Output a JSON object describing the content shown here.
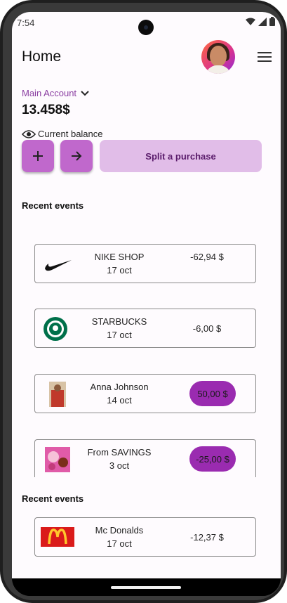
{
  "status_bar": {
    "time": "7:54"
  },
  "header": {
    "title": "Home"
  },
  "account": {
    "name": "Main Account",
    "balance": "13.458$",
    "balance_label": "Current balance"
  },
  "actions": {
    "add_icon": "plus-icon",
    "transfer_icon": "arrow-right-icon",
    "split_label": "Split a purchase"
  },
  "sections": {
    "recent_events_1": "Recent events",
    "recent_events_2": "Recent events"
  },
  "events": [
    {
      "name": "NIKE SHOP",
      "date": "17 oct",
      "amount": "-62,94 $",
      "logo": "nike-logo"
    },
    {
      "name": "STARBUCKS",
      "date": "17 oct",
      "amount": "-6,00 $",
      "logo": "starbucks-logo"
    },
    {
      "name": "Anna Johnson",
      "date": "14 oct",
      "amount": "50,00 $",
      "logo": "person-photo"
    },
    {
      "name": "From SAVINGS",
      "date": "3 oct",
      "amount": "-25,00 $",
      "logo": "savings-photo"
    },
    {
      "name": "Mc Donalds",
      "date": "17 oct",
      "amount": "-12,37 $",
      "logo": "mcdonalds-logo"
    }
  ],
  "colors": {
    "accent": "#9a2bb0",
    "button": "#c068cc",
    "button_light": "#e1bde8",
    "account_text": "#8a3ea1"
  }
}
